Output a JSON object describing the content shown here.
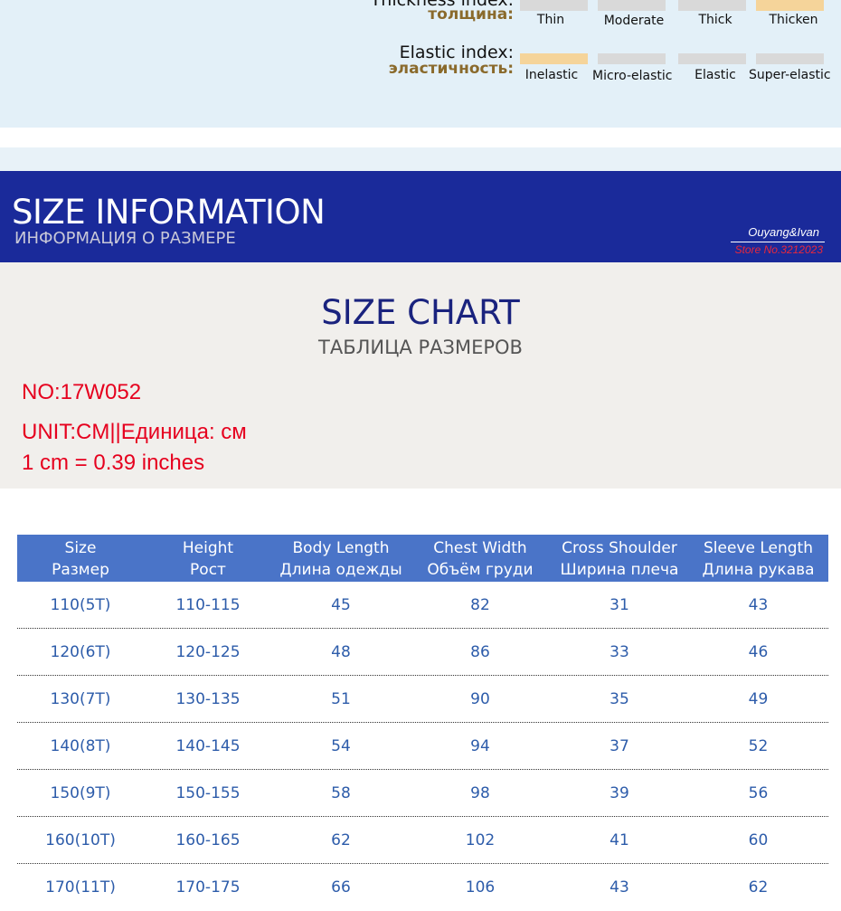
{
  "thickness_index": {
    "label_en": "Thickness index:",
    "label_ru": "толщина:",
    "options": [
      "Thin",
      "Moderate",
      "Thick",
      "Thicken"
    ],
    "selected": "Thicken"
  },
  "elastic_index": {
    "label_en": "Elastic index:",
    "label_ru": "эластичность:",
    "options": [
      "Inelastic",
      "Micro-elastic",
      "Elastic",
      "Super-elastic"
    ],
    "selected": "Inelastic"
  },
  "banner": {
    "title": "SIZE INFORMATION",
    "subtitle": "ИНФОРМАЦИЯ О РАЗМЕРЕ",
    "brand": "Ouyang&Ivan",
    "store": "Store No.3212023"
  },
  "size_chart": {
    "title": "SIZE CHART",
    "subtitle": "ТАБЛИЦА РАЗМЕРОВ",
    "number": "NO:17W052",
    "unit": "UNIT:CM||Единица: см",
    "conversion": "1 cm = 0.39 inches"
  },
  "table": {
    "headers": [
      {
        "en": "Size",
        "ru": "Размер"
      },
      {
        "en": "Height",
        "ru": "Рост"
      },
      {
        "en": "Body Length",
        "ru": "Длина одежды"
      },
      {
        "en": "Chest Width",
        "ru": "Объём груди"
      },
      {
        "en": "Cross Shoulder",
        "ru": "Ширина плеча"
      },
      {
        "en": "Sleeve Length",
        "ru": "Длина рукава"
      }
    ],
    "rows": [
      [
        "110(5T)",
        "110-115",
        "45",
        "82",
        "31",
        "43"
      ],
      [
        "120(6T)",
        "120-125",
        "48",
        "86",
        "33",
        "46"
      ],
      [
        "130(7T)",
        "130-135",
        "51",
        "90",
        "35",
        "49"
      ],
      [
        "140(8T)",
        "140-145",
        "54",
        "94",
        "37",
        "52"
      ],
      [
        "150(9T)",
        "150-155",
        "58",
        "98",
        "39",
        "56"
      ],
      [
        "160(10T)",
        "160-165",
        "62",
        "102",
        "41",
        "60"
      ],
      [
        "170(11T)",
        "170-175",
        "66",
        "106",
        "43",
        "62"
      ]
    ]
  },
  "colors": {
    "banner_bg": "#1a2a9a",
    "table_header_bg": "#4a74c8",
    "table_text": "#2d5caa",
    "accent_red": "#e6001e",
    "index_active": "#f5d49a",
    "index_inactive": "#d9d9d9"
  }
}
